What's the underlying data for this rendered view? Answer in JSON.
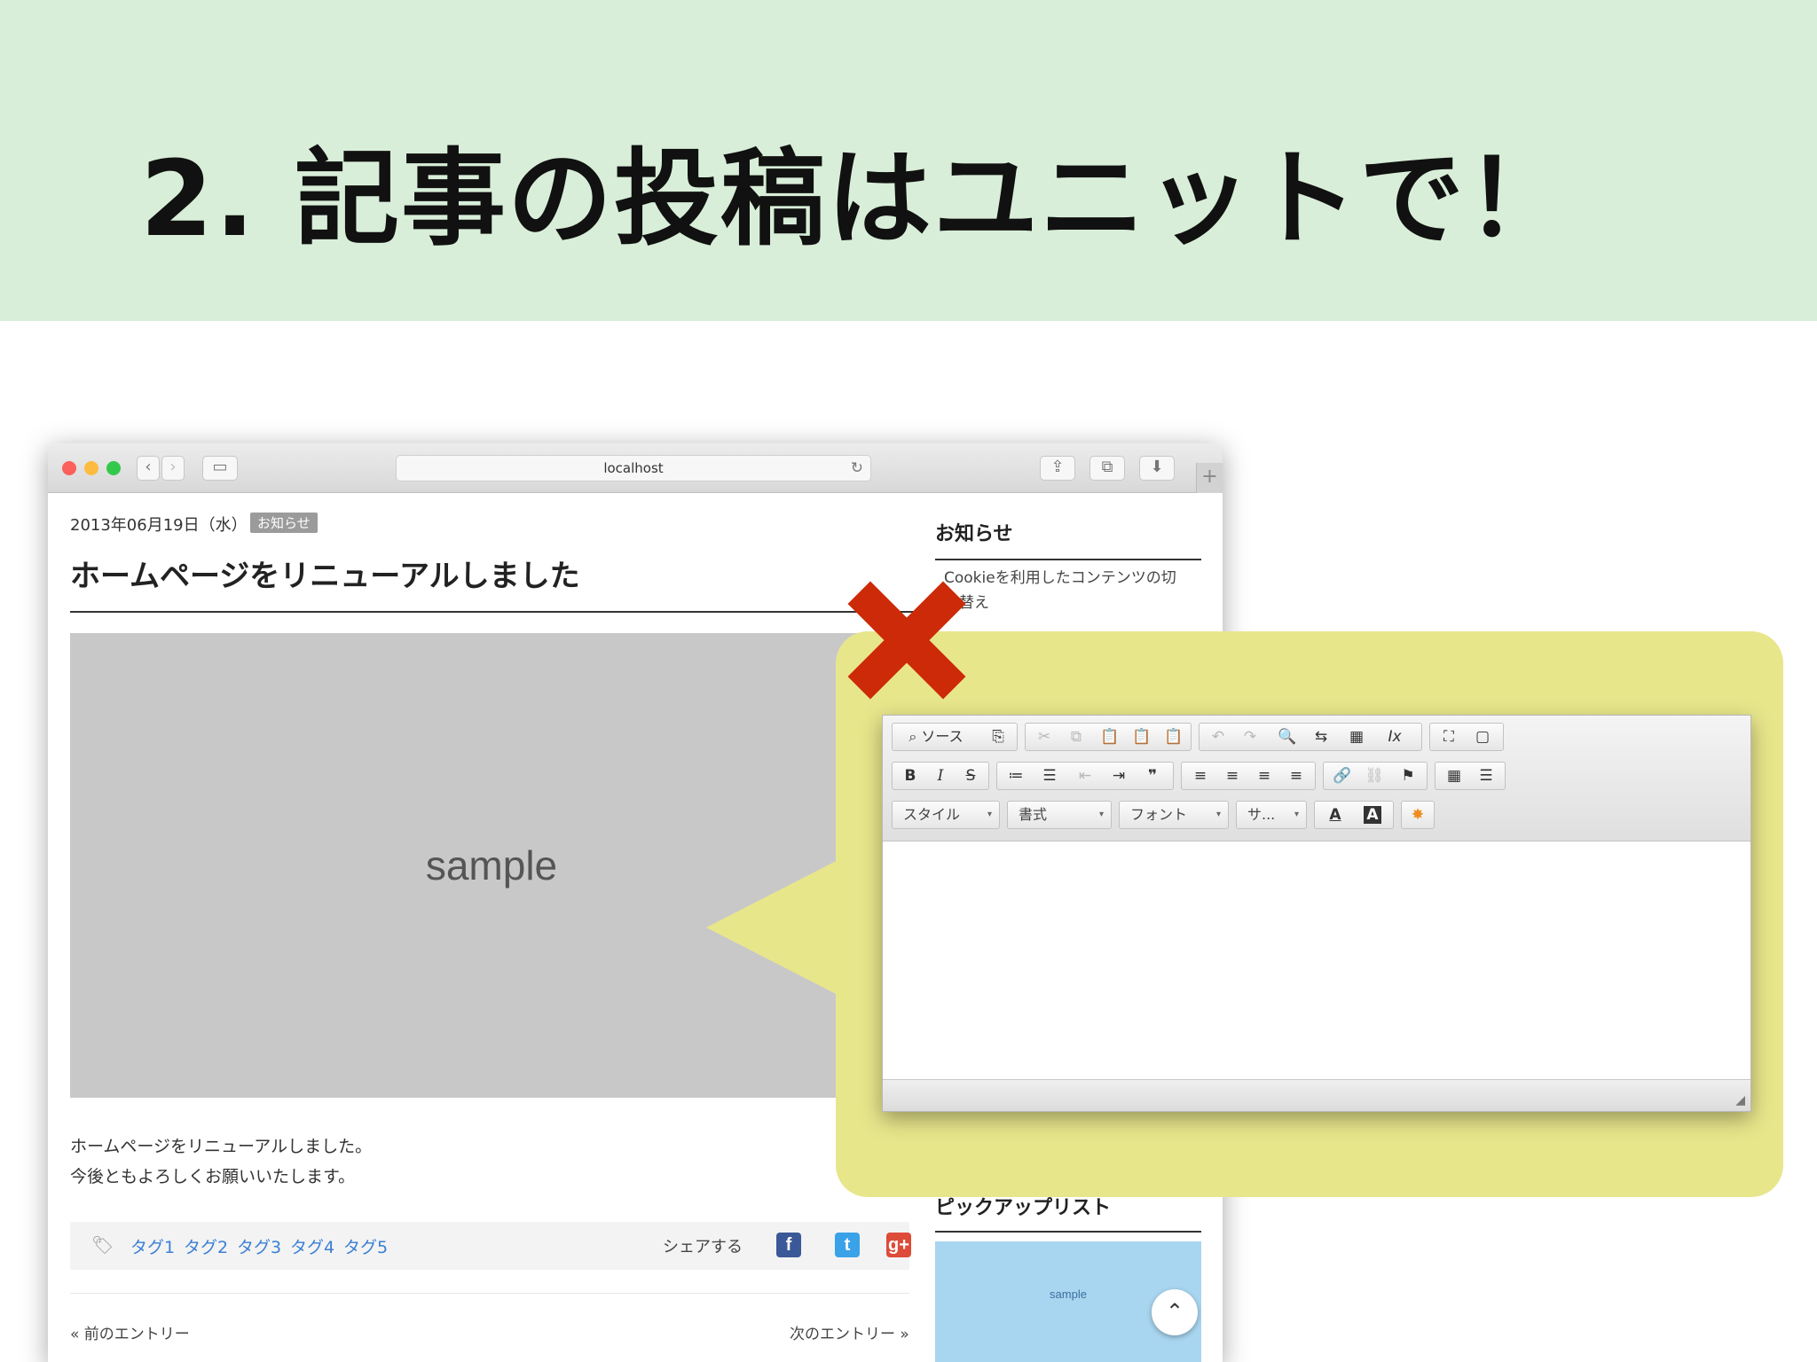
{
  "slide": {
    "title": "2. 記事の投稿はユニットで！"
  },
  "browser": {
    "url": "localhost",
    "back_icon": "‹",
    "forward_icon": "›",
    "sidebar_toggle_icon": "▭",
    "reload_icon": "↻",
    "share_icon": "⇪",
    "tabs_icon": "⧉",
    "download_icon": "⬇",
    "new_tab_icon": "+"
  },
  "post": {
    "date": "2013年06月19日（水）",
    "badge": "お知らせ",
    "title": "ホームページをリニューアルしました",
    "image_label": "sample",
    "body_line1": "ホームページをリニューアルしました。",
    "body_line2": "今後ともよろしくお願いいたします。",
    "tags": [
      "タグ1",
      "タグ2",
      "タグ3",
      "タグ4",
      "タグ5"
    ],
    "share_label": "シェアする",
    "prev_entry": "« 前のエントリー",
    "next_entry": "次のエントリー »"
  },
  "sidebar": {
    "news_heading": "お知らせ",
    "news_item": "Cookieを利用したコンテンツの切り替え",
    "pickup_heading": "ピックアップリスト",
    "pickup_image_label": "sample"
  },
  "social": {
    "facebook": "f",
    "twitter": "t",
    "googleplus": "g+"
  },
  "editor": {
    "source_label": "ソース",
    "style_label": "スタイル",
    "format_label": "書式",
    "font_label": "フォント",
    "size_label": "サ...",
    "toolbar_row1": [
      "⌕",
      "⎘",
      "✂",
      "⧉",
      "📋",
      "📋",
      "📋",
      "↶",
      "↷",
      "🔍",
      "⇆",
      "▦",
      "Ix",
      "⛶",
      "▢"
    ],
    "toolbar_row2": [
      "B",
      "I",
      "S",
      "≔",
      "☰",
      "⇤",
      "⇥",
      "❞",
      "≡",
      "≡",
      "≡",
      "≡",
      "🔗",
      "⛓",
      "⚑",
      "▦",
      "☰"
    ],
    "text_color": "A",
    "bg_color": "A",
    "special": "✸"
  },
  "colors": {
    "header_band": "#d8eed8",
    "callout": "#e8e68b",
    "cross": "#cc2a08",
    "tag_link": "#3a7fd5"
  }
}
